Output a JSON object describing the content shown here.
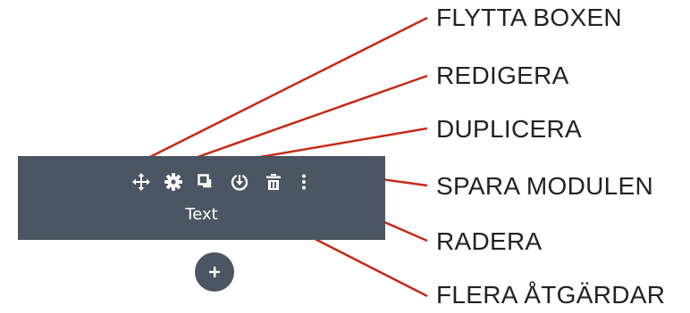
{
  "colors": {
    "bar_background": "#4b5563",
    "icon_color": "#ffffff",
    "callout_line": "#c62a17",
    "label_text": "#222222",
    "add_button_background": "#4b5563"
  },
  "module": {
    "label": "Text",
    "toolbar": [
      {
        "id": "move",
        "icon": "move-arrows-icon"
      },
      {
        "id": "settings",
        "icon": "gear-icon"
      },
      {
        "id": "duplicate",
        "icon": "duplicate-icon"
      },
      {
        "id": "save",
        "icon": "save-download-icon"
      },
      {
        "id": "delete",
        "icon": "trash-icon"
      },
      {
        "id": "more",
        "icon": "vertical-dots-icon"
      }
    ]
  },
  "add_button": {
    "icon": "plus-icon"
  },
  "callouts": [
    {
      "label": "FLYTTA BOXEN"
    },
    {
      "label": "REDIGERA"
    },
    {
      "label": "DUPLICERA"
    },
    {
      "label": "SPARA MODULEN"
    },
    {
      "label": "RADERA"
    },
    {
      "label": "FLERA ÅTGÄRDAR"
    }
  ]
}
